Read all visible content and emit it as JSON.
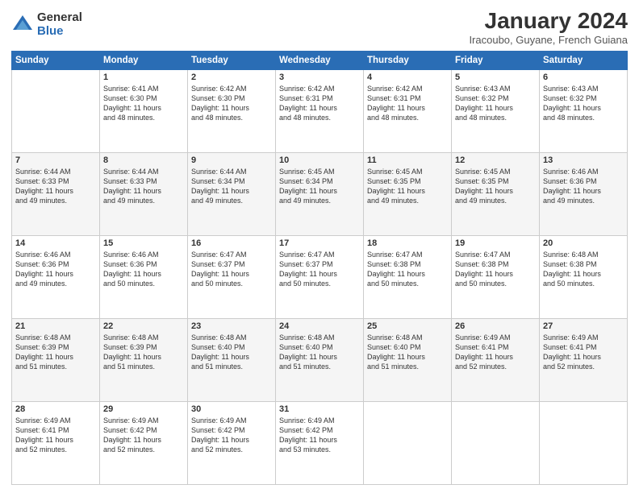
{
  "logo": {
    "general": "General",
    "blue": "Blue"
  },
  "header": {
    "month_year": "January 2024",
    "location": "Iracoubo, Guyane, French Guiana"
  },
  "days": [
    "Sunday",
    "Monday",
    "Tuesday",
    "Wednesday",
    "Thursday",
    "Friday",
    "Saturday"
  ],
  "weeks": [
    [
      {
        "day": "",
        "info": ""
      },
      {
        "day": "1",
        "info": "Sunrise: 6:41 AM\nSunset: 6:30 PM\nDaylight: 11 hours\nand 48 minutes."
      },
      {
        "day": "2",
        "info": "Sunrise: 6:42 AM\nSunset: 6:30 PM\nDaylight: 11 hours\nand 48 minutes."
      },
      {
        "day": "3",
        "info": "Sunrise: 6:42 AM\nSunset: 6:31 PM\nDaylight: 11 hours\nand 48 minutes."
      },
      {
        "day": "4",
        "info": "Sunrise: 6:42 AM\nSunset: 6:31 PM\nDaylight: 11 hours\nand 48 minutes."
      },
      {
        "day": "5",
        "info": "Sunrise: 6:43 AM\nSunset: 6:32 PM\nDaylight: 11 hours\nand 48 minutes."
      },
      {
        "day": "6",
        "info": "Sunrise: 6:43 AM\nSunset: 6:32 PM\nDaylight: 11 hours\nand 48 minutes."
      }
    ],
    [
      {
        "day": "7",
        "info": "Sunrise: 6:44 AM\nSunset: 6:33 PM\nDaylight: 11 hours\nand 49 minutes."
      },
      {
        "day": "8",
        "info": "Sunrise: 6:44 AM\nSunset: 6:33 PM\nDaylight: 11 hours\nand 49 minutes."
      },
      {
        "day": "9",
        "info": "Sunrise: 6:44 AM\nSunset: 6:34 PM\nDaylight: 11 hours\nand 49 minutes."
      },
      {
        "day": "10",
        "info": "Sunrise: 6:45 AM\nSunset: 6:34 PM\nDaylight: 11 hours\nand 49 minutes."
      },
      {
        "day": "11",
        "info": "Sunrise: 6:45 AM\nSunset: 6:35 PM\nDaylight: 11 hours\nand 49 minutes."
      },
      {
        "day": "12",
        "info": "Sunrise: 6:45 AM\nSunset: 6:35 PM\nDaylight: 11 hours\nand 49 minutes."
      },
      {
        "day": "13",
        "info": "Sunrise: 6:46 AM\nSunset: 6:36 PM\nDaylight: 11 hours\nand 49 minutes."
      }
    ],
    [
      {
        "day": "14",
        "info": "Sunrise: 6:46 AM\nSunset: 6:36 PM\nDaylight: 11 hours\nand 49 minutes."
      },
      {
        "day": "15",
        "info": "Sunrise: 6:46 AM\nSunset: 6:36 PM\nDaylight: 11 hours\nand 50 minutes."
      },
      {
        "day": "16",
        "info": "Sunrise: 6:47 AM\nSunset: 6:37 PM\nDaylight: 11 hours\nand 50 minutes."
      },
      {
        "day": "17",
        "info": "Sunrise: 6:47 AM\nSunset: 6:37 PM\nDaylight: 11 hours\nand 50 minutes."
      },
      {
        "day": "18",
        "info": "Sunrise: 6:47 AM\nSunset: 6:38 PM\nDaylight: 11 hours\nand 50 minutes."
      },
      {
        "day": "19",
        "info": "Sunrise: 6:47 AM\nSunset: 6:38 PM\nDaylight: 11 hours\nand 50 minutes."
      },
      {
        "day": "20",
        "info": "Sunrise: 6:48 AM\nSunset: 6:38 PM\nDaylight: 11 hours\nand 50 minutes."
      }
    ],
    [
      {
        "day": "21",
        "info": "Sunrise: 6:48 AM\nSunset: 6:39 PM\nDaylight: 11 hours\nand 51 minutes."
      },
      {
        "day": "22",
        "info": "Sunrise: 6:48 AM\nSunset: 6:39 PM\nDaylight: 11 hours\nand 51 minutes."
      },
      {
        "day": "23",
        "info": "Sunrise: 6:48 AM\nSunset: 6:40 PM\nDaylight: 11 hours\nand 51 minutes."
      },
      {
        "day": "24",
        "info": "Sunrise: 6:48 AM\nSunset: 6:40 PM\nDaylight: 11 hours\nand 51 minutes."
      },
      {
        "day": "25",
        "info": "Sunrise: 6:48 AM\nSunset: 6:40 PM\nDaylight: 11 hours\nand 51 minutes."
      },
      {
        "day": "26",
        "info": "Sunrise: 6:49 AM\nSunset: 6:41 PM\nDaylight: 11 hours\nand 52 minutes."
      },
      {
        "day": "27",
        "info": "Sunrise: 6:49 AM\nSunset: 6:41 PM\nDaylight: 11 hours\nand 52 minutes."
      }
    ],
    [
      {
        "day": "28",
        "info": "Sunrise: 6:49 AM\nSunset: 6:41 PM\nDaylight: 11 hours\nand 52 minutes."
      },
      {
        "day": "29",
        "info": "Sunrise: 6:49 AM\nSunset: 6:42 PM\nDaylight: 11 hours\nand 52 minutes."
      },
      {
        "day": "30",
        "info": "Sunrise: 6:49 AM\nSunset: 6:42 PM\nDaylight: 11 hours\nand 52 minutes."
      },
      {
        "day": "31",
        "info": "Sunrise: 6:49 AM\nSunset: 6:42 PM\nDaylight: 11 hours\nand 53 minutes."
      },
      {
        "day": "",
        "info": ""
      },
      {
        "day": "",
        "info": ""
      },
      {
        "day": "",
        "info": ""
      }
    ]
  ]
}
